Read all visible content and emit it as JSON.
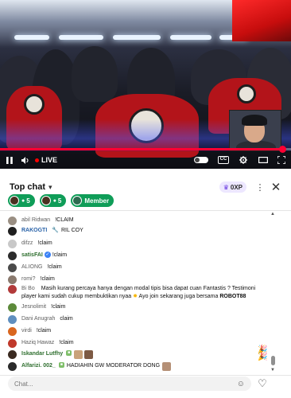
{
  "player": {
    "live_label": "LIVE",
    "progress_percent": 97
  },
  "chat": {
    "title": "Top chat",
    "xp_label": "0XP",
    "pills": [
      {
        "count": "5"
      },
      {
        "count": "5"
      },
      {
        "label": "Member"
      }
    ],
    "messages": [
      {
        "author": "abil Ridwan",
        "text": "!CLAIM",
        "avatar_color": "#9a8f83",
        "author_style": "plain"
      },
      {
        "author": "RAKOGTI",
        "text": "RIL COY",
        "avatar_color": "#1f1f1f",
        "author_style": "verified"
      },
      {
        "author": "difzz",
        "text": "!claim",
        "avatar_color": "#c8c8c8",
        "author_style": "plain"
      },
      {
        "author": "satisFAI",
        "text": "!claim",
        "avatar_color": "#2b2b2b",
        "author_style": "mod"
      },
      {
        "author": "ALIONG",
        "text": "!claim",
        "avatar_color": "#4a4a4a",
        "author_style": "plain"
      },
      {
        "author": "romi?",
        "text": "!claim",
        "avatar_color": "#8a7a6e",
        "author_style": "plain"
      },
      {
        "author": "Bi Bo",
        "text": "Masih kurang percaya hanya dengan modal tipis bisa dapat cuan Fantastis ? Testimoni player kami sudah cukup membuktikan nyaa",
        "text_cont": "Ayo join sekarang juga bersama",
        "text_bold": "ROBOT88",
        "avatar_color": "#b23a3a",
        "author_style": "plain"
      },
      {
        "author": "Jesnolimit",
        "text": "!claim",
        "avatar_color": "#5c8a3a",
        "author_style": "plain"
      },
      {
        "author": "Dani Anugrah",
        "text": "claim",
        "avatar_color": "#5f8fbf",
        "author_style": "plain"
      },
      {
        "author": "virdi",
        "text": "!claim",
        "avatar_color": "#d9661f",
        "author_style": "plain"
      },
      {
        "author": "Haziq Hawaz",
        "text": "!claim",
        "avatar_color": "#c0392b",
        "author_style": "plain"
      },
      {
        "author": "Iskandar Lutfhy",
        "text": "",
        "avatar_color": "#3a2a20",
        "author_style": "mod"
      },
      {
        "author": "Alfarizi. 002_",
        "text": "HADIAHIN GW MODERATOR DONG",
        "avatar_color": "#2a2a2a",
        "author_style": "mod"
      }
    ],
    "input_placeholder": "Chat..."
  },
  "icons": {
    "play": "pause-icon",
    "settings": "gear-icon",
    "theater": "theater-icon",
    "fullscreen": "fullscreen-icon",
    "close": "close-icon",
    "more": "kebab-icon",
    "emoji": "emoji-icon",
    "heart": "heart-icon"
  },
  "colors": {
    "accent_red": "#ff0033",
    "member_green": "#0f9d58",
    "xp_badge_bg": "#ede7ff"
  }
}
